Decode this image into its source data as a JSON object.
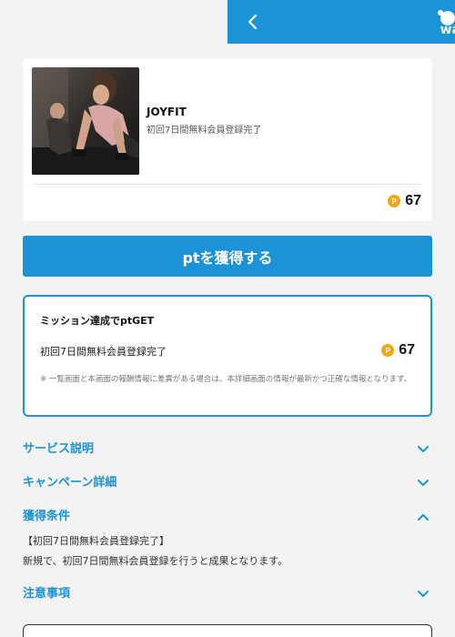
{
  "header": {
    "logo_text": "wa",
    "back_icon": "chevron-left-icon"
  },
  "offer": {
    "title": "JOYFIT",
    "subtitle": "初回7日間無料会員登録完了",
    "coin_symbol": "P",
    "points": "67"
  },
  "action": {
    "get_points_label": "ptを獲得する"
  },
  "mission": {
    "title": "ミッション達成でptGET",
    "item_label": "初回7日間無料会員登録完了",
    "coin_symbol": "P",
    "points": "67",
    "note": "※ 一覧画面と本画面の報酬情報に差異がある場合は、本詳細画面の情報が最新かつ正確な情報となります。"
  },
  "sections": {
    "service": {
      "label": "サービス説明",
      "state": "collapsed"
    },
    "campaign": {
      "label": "キャンペーン詳細",
      "state": "collapsed"
    },
    "conditions": {
      "label": "獲得条件",
      "state": "expanded",
      "line1": "【初回7日間無料会員登録完了】",
      "line2": "新規で、初回7日間無料会員登録を行うと成果となります。"
    },
    "notes": {
      "label": "注意事項",
      "state": "collapsed"
    }
  },
  "colors": {
    "brand_blue": "#1c93d6",
    "coin_orange": "#f0a818",
    "background": "#f3f3f3"
  }
}
